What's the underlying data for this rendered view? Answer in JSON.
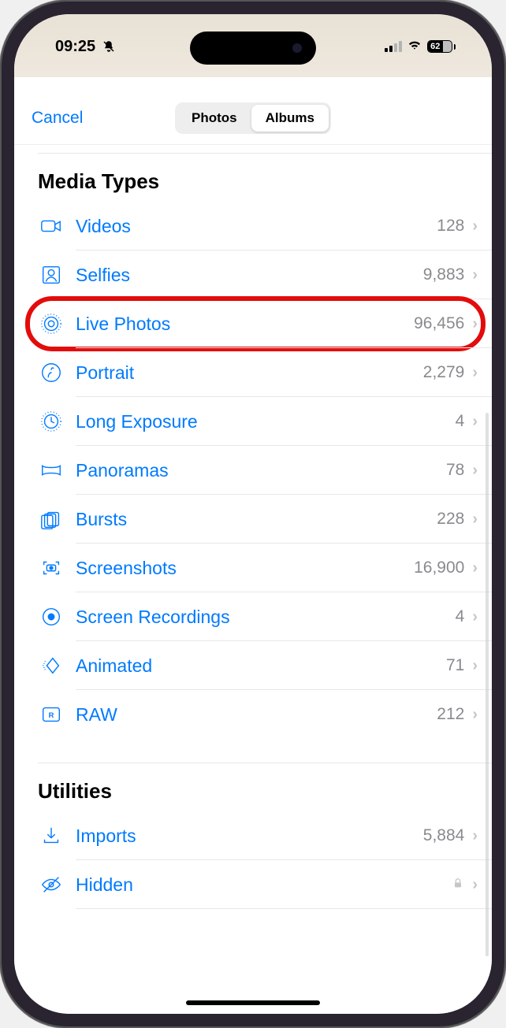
{
  "status": {
    "time": "09:25",
    "battery": "62"
  },
  "nav": {
    "cancel": "Cancel",
    "seg_photos": "Photos",
    "seg_albums": "Albums"
  },
  "sections": {
    "media_types": {
      "title": "Media Types",
      "items": [
        {
          "label": "Videos",
          "count": "128"
        },
        {
          "label": "Selfies",
          "count": "9,883"
        },
        {
          "label": "Live Photos",
          "count": "96,456"
        },
        {
          "label": "Portrait",
          "count": "2,279"
        },
        {
          "label": "Long Exposure",
          "count": "4"
        },
        {
          "label": "Panoramas",
          "count": "78"
        },
        {
          "label": "Bursts",
          "count": "228"
        },
        {
          "label": "Screenshots",
          "count": "16,900"
        },
        {
          "label": "Screen Recordings",
          "count": "4"
        },
        {
          "label": "Animated",
          "count": "71"
        },
        {
          "label": "RAW",
          "count": "212"
        }
      ]
    },
    "utilities": {
      "title": "Utilities",
      "items": [
        {
          "label": "Imports",
          "count": "5,884"
        },
        {
          "label": "Hidden",
          "count": ""
        }
      ]
    }
  }
}
